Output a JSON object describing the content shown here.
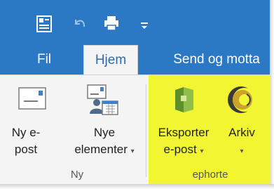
{
  "tabs": {
    "file": "Fil",
    "home": "Hjem",
    "send_receive": "Send og motta"
  },
  "groups": {
    "new": {
      "label": "Ny",
      "buttons": {
        "new_email": {
          "line1": "Ny e-",
          "line2": "post"
        },
        "new_items": {
          "line1": "Nye",
          "line2": "elementer",
          "caret": "▾"
        }
      }
    },
    "ephorte": {
      "label": "ephorte",
      "buttons": {
        "export_email": {
          "line1": "Eksporter",
          "line2": "e-post",
          "caret": "▾"
        },
        "archive": {
          "line1": "Arkiv",
          "caret": "▾"
        }
      }
    }
  },
  "colors": {
    "title_bar": "#2b79c4",
    "highlight": "#f2f532",
    "active_tab_text": "#2b6ab5"
  },
  "icons": [
    "new-window-icon",
    "undo-icon",
    "print-icon",
    "customize-qat-icon",
    "envelope-icon",
    "new-items-icon",
    "export-folder-icon",
    "archive-icon"
  ]
}
